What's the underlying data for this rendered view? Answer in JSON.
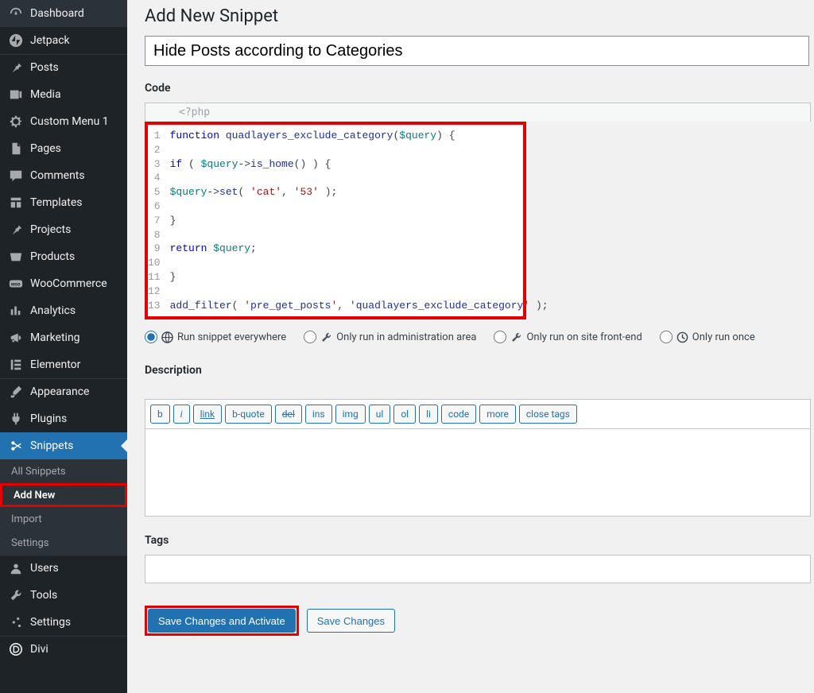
{
  "sidebar": {
    "items": [
      {
        "label": "Dashboard",
        "icon": "gauge"
      },
      {
        "label": "Jetpack",
        "icon": "jetpack"
      },
      {
        "label": "Posts",
        "icon": "pin"
      },
      {
        "label": "Media",
        "icon": "media"
      },
      {
        "label": "Custom Menu 1",
        "icon": "gear"
      },
      {
        "label": "Pages",
        "icon": "pages"
      },
      {
        "label": "Comments",
        "icon": "comment"
      },
      {
        "label": "Templates",
        "icon": "templates"
      },
      {
        "label": "Projects",
        "icon": "pin"
      },
      {
        "label": "Products",
        "icon": "product"
      },
      {
        "label": "WooCommerce",
        "icon": "woo"
      },
      {
        "label": "Analytics",
        "icon": "bars"
      },
      {
        "label": "Marketing",
        "icon": "megaphone"
      },
      {
        "label": "Elementor",
        "icon": "elementor"
      },
      {
        "label": "Appearance",
        "icon": "brush"
      },
      {
        "label": "Plugins",
        "icon": "plug"
      },
      {
        "label": "Snippets",
        "icon": "scissors",
        "active": true
      },
      {
        "label": "Users",
        "icon": "user"
      },
      {
        "label": "Tools",
        "icon": "wrench"
      },
      {
        "label": "Settings",
        "icon": "sliders"
      },
      {
        "label": "Divi",
        "icon": "divi"
      }
    ],
    "sub": [
      {
        "label": "All Snippets"
      },
      {
        "label": "Add New",
        "current": true
      },
      {
        "label": "Import"
      },
      {
        "label": "Settings"
      }
    ]
  },
  "page": {
    "title": "Add New Snippet",
    "name_value": "Hide Posts according to Categories",
    "code_label": "Code",
    "php_hint": "<?php",
    "description_label": "Description",
    "tags_label": "Tags"
  },
  "code_lines": [
    "function quadlayers_exclude_category($query) {",
    "",
    "if ( $query->is_home() ) {",
    "",
    "$query->set( 'cat', '53' );",
    "",
    "}",
    "",
    "return $query;",
    "",
    "}",
    "",
    "add_filter( 'pre_get_posts', 'quadlayers_exclude_category' );"
  ],
  "scope": {
    "everywhere": "Run snippet everywhere",
    "admin": "Only run in administration area",
    "front": "Only run on site front-end",
    "once": "Only run once"
  },
  "quicktags": [
    "b",
    "i",
    "link",
    "b-quote",
    "del",
    "ins",
    "img",
    "ul",
    "ol",
    "li",
    "code",
    "more",
    "close tags"
  ],
  "buttons": {
    "save_activate": "Save Changes and Activate",
    "save": "Save Changes"
  }
}
